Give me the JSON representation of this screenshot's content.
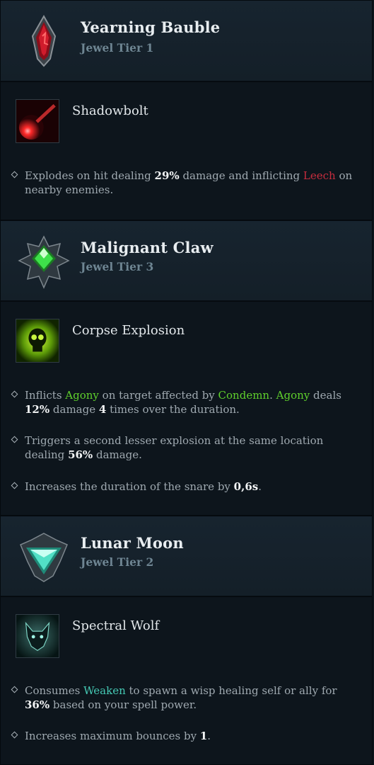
{
  "sections": [
    {
      "jewel": {
        "name": "Yearning Bauble",
        "tier": "Jewel Tier 1",
        "icon": "red-crystal-icon"
      },
      "skill": {
        "name": "Shadowbolt",
        "icon": "shadowbolt-icon"
      },
      "bullets": [
        [
          "Explodes on hit dealing ",
          "29%",
          " damage and inflicting ",
          "Leech",
          "",
          "",
          "",
          "",
          " on nearby enemies."
        ]
      ]
    },
    {
      "jewel": {
        "name": "Malignant Claw",
        "tier": "Jewel Tier 3",
        "icon": "green-gem-icon"
      },
      "skill": {
        "name": "Corpse Explosion",
        "icon": "skull-icon"
      },
      "bullets": [
        [
          "Inflicts ",
          "Agony",
          " on target affected by ",
          "Condemn",
          ". ",
          "Agony",
          " deals ",
          "12%",
          " damage ",
          "4",
          " times over the duration."
        ],
        [
          "Triggers a second lesser explosion at the same location dealing ",
          "56%",
          " damage."
        ],
        [
          "Increases the duration of the snare by ",
          "0,6s",
          "."
        ]
      ]
    },
    {
      "jewel": {
        "name": "Lunar Moon",
        "tier": "Jewel Tier 2",
        "icon": "teal-gem-icon"
      },
      "skill": {
        "name": "Spectral Wolf",
        "icon": "wolf-icon"
      },
      "bullets": [
        [
          "Consumes ",
          "Weaken",
          " to spawn a wisp healing self or ally for ",
          "36%",
          " based on your spell power."
        ],
        [
          "Increases maximum bounces by ",
          "1",
          "."
        ]
      ]
    }
  ],
  "colors": {
    "highlight_red": "#c72d3e",
    "highlight_green": "#5fd02c",
    "highlight_teal": "#45c9b4"
  }
}
